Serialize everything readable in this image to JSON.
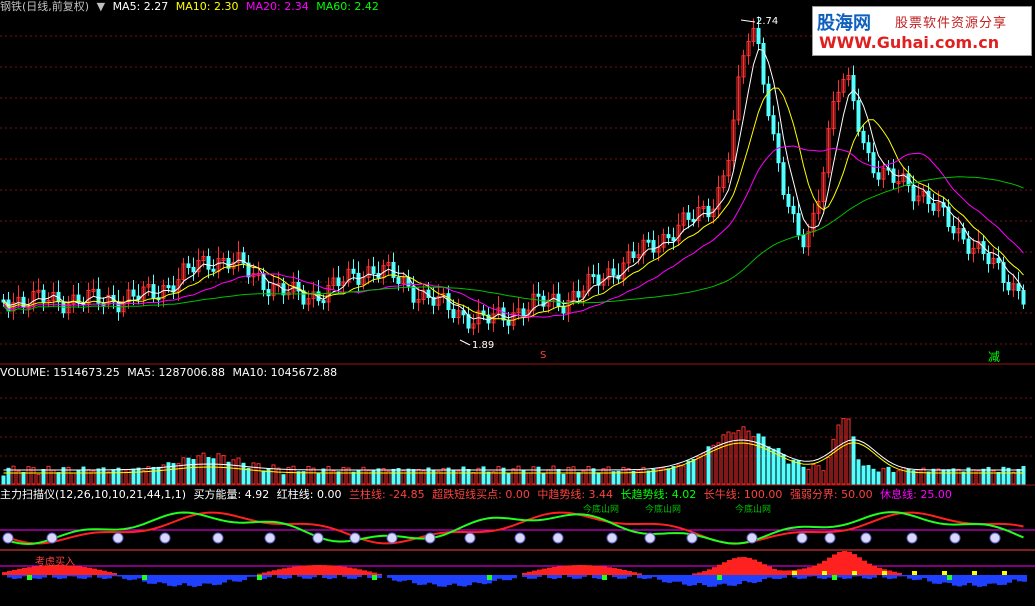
{
  "main_header": {
    "title": "钢铁(日线,前复权)",
    "items": [
      {
        "label": "MA5: 2.27",
        "color": "#ffffff"
      },
      {
        "label": "MA10: 2.30",
        "color": "#ffff00"
      },
      {
        "label": "MA20: 2.34",
        "color": "#ff00ff"
      },
      {
        "label": "MA60: 2.42",
        "color": "#00ff00"
      }
    ]
  },
  "price_labels": {
    "high": "2.74",
    "low": "1.89",
    "marker_s": "S",
    "marker_jian": "减"
  },
  "volume_header": {
    "items": [
      {
        "label": "VOLUME: 1514673.25",
        "color": "#ffffff"
      },
      {
        "label": "MA5: 1287006.88",
        "color": "#ffffff"
      },
      {
        "label": "MA10: 1045672.88",
        "color": "#ffffff"
      }
    ]
  },
  "indicator_header": {
    "items": [
      {
        "label": "主力扫描仪(12,26,10,10,21,44,1,1)",
        "color": "#ffffff"
      },
      {
        "label": "买方能量: 4.92",
        "color": "#ffffff"
      },
      {
        "label": "红柱线: 0.00",
        "color": "#ffffff"
      },
      {
        "label": "兰柱线: -24.85",
        "color": "#ff4040"
      },
      {
        "label": "超跌短线买点: 0.00",
        "color": "#ff4040"
      },
      {
        "label": "中趋势线: 3.44",
        "color": "#ff4040"
      },
      {
        "label": "长趋势线: 4.02",
        "color": "#00ff00"
      },
      {
        "label": "长牛线: 100.00",
        "color": "#ff4040"
      },
      {
        "label": "强弱分界: 50.00",
        "color": "#ff4040"
      },
      {
        "label": "休息线: 25.00",
        "color": "#ff00ff"
      }
    ]
  },
  "indicator_labels": {
    "buy_hint": "考虑买入",
    "sub_labels": [
      "今底山网",
      "今底山网",
      "今底山网"
    ]
  },
  "watermark": {
    "brand": "股海网",
    "tagline": "股票软件资源分享",
    "url": "WWW.Guhai.com.cn"
  }
}
